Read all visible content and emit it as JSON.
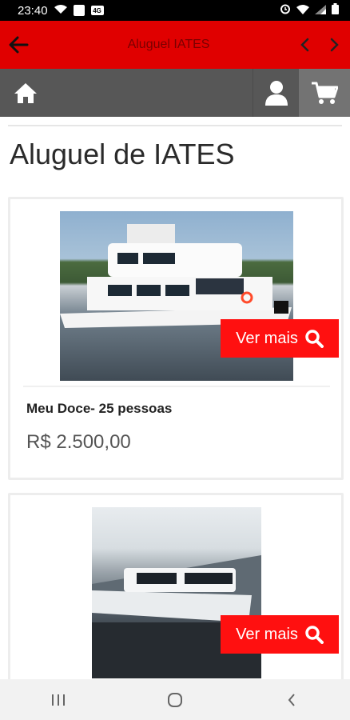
{
  "status_bar": {
    "time": "23:40",
    "sim_label": "4G",
    "colors": {
      "background": "#000000",
      "text": "#ffffff"
    }
  },
  "app_bar": {
    "title": "Aluguel IATES",
    "back_icon": "arrow-left-icon",
    "prev_icon": "chevron-left-icon",
    "next_icon": "chevron-right-icon",
    "colors": {
      "background": "#e00000",
      "title": "#7a0000"
    }
  },
  "toolbar": {
    "home_icon": "home-icon",
    "user_icon": "user-icon",
    "cart_icon": "cart-icon",
    "colors": {
      "background": "#575757",
      "cart_background": "#737373"
    }
  },
  "page": {
    "title": "Aluguel de IATES"
  },
  "products": [
    {
      "name": "Meu Doce- 25 pessoas",
      "price": "R$ 2.500,00",
      "button_label": "Ver mais"
    },
    {
      "name": "",
      "price": "",
      "button_label": "Ver mais"
    }
  ],
  "accent_color": "#ff1010",
  "bottom_nav": {
    "recents_icon": "recents-icon",
    "home_icon": "home-circle-icon",
    "back_icon": "back-chevron-icon"
  }
}
